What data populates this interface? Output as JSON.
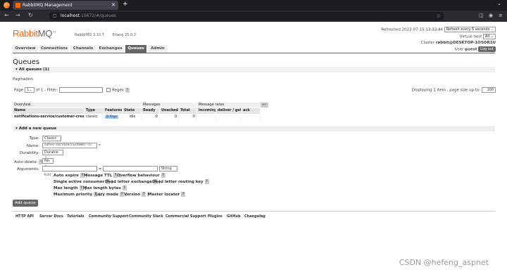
{
  "browser": {
    "tab_title": "RabbitMQ Management",
    "url_host": "localhost",
    "url_rest": ":15672/#/queues"
  },
  "header": {
    "logo_main": "Rabbit",
    "logo_mq": "MQ",
    "logo_tm": "TM",
    "rabbitmq_version": "RabbitMQ 3.10.7",
    "erlang_version": "Erlang 25.0.3",
    "refreshed": "Refreshed 2023-07-15 13:33:44",
    "refresh_option": "Refresh every 5 seconds",
    "vhost_label": "Virtual host",
    "vhost_value": "All",
    "cluster_label": "Cluster",
    "cluster_value": "rabbit@DESKTOP-1OSOR1U",
    "user_label": "User",
    "user_value": "guest",
    "logout": "Log out"
  },
  "tabs": [
    "Overview",
    "Connections",
    "Channels",
    "Exchanges",
    "Queues",
    "Admin"
  ],
  "active_tab": "Queues",
  "page_title": "Queues",
  "all_queues": "All queues (1)",
  "pagination": {
    "heading": "Pagination",
    "page_label": "Page",
    "page_value": "1",
    "of_label": "of 1",
    "filter_label": "- Filter:",
    "regex_label": "Regex",
    "help": "?",
    "display_text": "Displaying 1 item , page size up to:",
    "page_size": "100"
  },
  "table": {
    "groups": [
      "Overview",
      "Messages",
      "Message rates"
    ],
    "plusminus": "+/-",
    "headers": [
      "Name",
      "Type",
      "Features",
      "State",
      "Ready",
      "Unacked",
      "Total",
      "incoming",
      "deliver / get",
      "ack"
    ],
    "rows": [
      {
        "name": "notifications-service/customer-created",
        "type": "classic",
        "features": "D Args",
        "state": "idle",
        "ready": "0",
        "unacked": "0",
        "total": "0",
        "incoming": "",
        "deliver": "",
        "ack": ""
      }
    ]
  },
  "add_queue": {
    "heading": "Add a new queue",
    "type_label": "Type:",
    "type_value": "Classic",
    "name_label": "Name:",
    "name_value": "sales-service/customer-cr",
    "name_star": "*",
    "durability_label": "Durability:",
    "durability_value": "Durable",
    "autodelete_label": "Auto delete:",
    "autodelete_help": "?",
    "autodelete_value": "No",
    "arguments_label": "Arguments:",
    "equals": "=",
    "arg_type": "String",
    "add_label": "Add",
    "args": [
      [
        "Auto expire",
        "Message TTL",
        "Overflow behaviour"
      ],
      [
        "Single active consumer",
        "Dead letter exchange",
        "Dead letter routing key"
      ],
      [
        "Max length",
        "Max length bytes"
      ],
      [
        "Maximum priority",
        "Lazy mode",
        "Version",
        "Master locator"
      ]
    ],
    "submit": "Add queue"
  },
  "footer": [
    "HTTP API",
    "Server Docs",
    "Tutorials",
    "Community Support",
    "Community Slack",
    "Commercial Support",
    "Plugins",
    "GitHub",
    "Changelog"
  ],
  "watermark": "CSDN @hefeng_aspnet"
}
